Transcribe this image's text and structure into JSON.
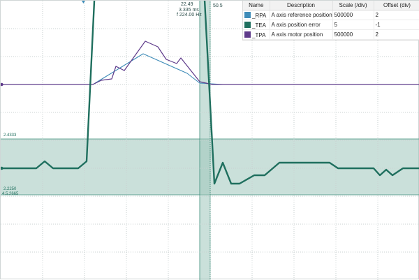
{
  "colors": {
    "reference": "#3f8cb8",
    "error": "#1f6f5e",
    "motor": "#5e3a8a",
    "band": "#9fc7bb",
    "grid": "#c9d0d0"
  },
  "cursor": {
    "dx": "22.49",
    "dt": "3.335 ms",
    "freq": "f 224.00 Hz",
    "tag": "50.5"
  },
  "band": {
    "upper": "2.4333",
    "lower": "2.2250",
    "lower2": "4.5.2665"
  },
  "legend": {
    "headers": [
      "Name",
      "Description",
      "Scale (/div)",
      "Offset (div)"
    ],
    "rows": [
      {
        "swatch": "reference",
        "name": "_RPA",
        "description": "A axis reference position",
        "scale": "500000",
        "offset": "2"
      },
      {
        "swatch": "error",
        "name": "_TEA",
        "description": "A axis position error",
        "scale": "5",
        "offset": "-1"
      },
      {
        "swatch": "motor",
        "name": "_TPA",
        "description": "A axis motor position",
        "scale": "500000",
        "offset": "2"
      }
    ]
  },
  "chart_data": {
    "type": "line",
    "divisions": {
      "x": 10,
      "y": 10
    },
    "series": [
      {
        "name": "_RPA",
        "points": [
          [
            0.0,
            7.0
          ],
          [
            2.2,
            7.0
          ],
          [
            3.4,
            8.1
          ],
          [
            4.45,
            7.4
          ],
          [
            4.75,
            7.05
          ],
          [
            5.3,
            7.0
          ],
          [
            10.0,
            7.0
          ]
        ]
      },
      {
        "name": "_TPA",
        "points": [
          [
            0.0,
            7.0
          ],
          [
            2.2,
            7.0
          ],
          [
            2.4,
            7.15
          ],
          [
            2.65,
            7.2
          ],
          [
            2.75,
            7.65
          ],
          [
            2.95,
            7.5
          ],
          [
            3.45,
            8.55
          ],
          [
            3.75,
            8.35
          ],
          [
            3.95,
            7.9
          ],
          [
            4.2,
            7.75
          ],
          [
            4.3,
            7.95
          ],
          [
            4.75,
            7.1
          ],
          [
            5.05,
            7.0
          ],
          [
            10.0,
            7.0
          ]
        ]
      },
      {
        "name": "_TEA",
        "points": [
          [
            0.0,
            4.0
          ],
          [
            0.85,
            4.0
          ],
          [
            1.05,
            4.25
          ],
          [
            1.25,
            4.0
          ],
          [
            1.85,
            4.0
          ],
          [
            2.05,
            4.25
          ],
          [
            2.25,
            10.5
          ],
          [
            4.85,
            10.5
          ],
          [
            5.1,
            3.45
          ],
          [
            5.3,
            4.2
          ],
          [
            5.5,
            3.45
          ],
          [
            5.7,
            3.45
          ],
          [
            6.05,
            3.75
          ],
          [
            6.3,
            3.75
          ],
          [
            6.65,
            4.2
          ],
          [
            7.85,
            4.2
          ],
          [
            8.05,
            4.0
          ],
          [
            8.9,
            4.0
          ],
          [
            9.05,
            3.75
          ],
          [
            9.2,
            3.95
          ],
          [
            9.35,
            3.75
          ],
          [
            9.6,
            4.0
          ],
          [
            10.0,
            4.0
          ]
        ]
      }
    ],
    "error_band": [
      3.05,
      5.05
    ],
    "cursor_band": [
      4.75,
      5.0
    ],
    "grid": true
  }
}
